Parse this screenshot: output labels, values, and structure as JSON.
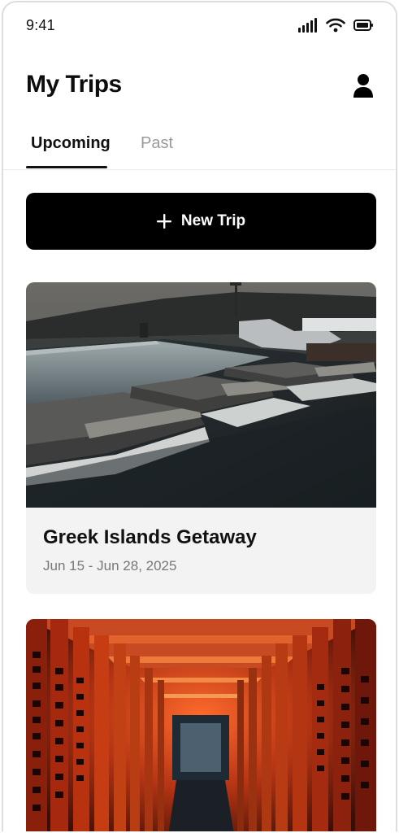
{
  "status_bar": {
    "time": "9:41",
    "icons": [
      "cellular-signal-icon",
      "wifi-icon",
      "battery-icon"
    ]
  },
  "header": {
    "title": "My Trips",
    "profile_icon": "user-icon"
  },
  "tabs": [
    {
      "label": "Upcoming",
      "active": true
    },
    {
      "label": "Past",
      "active": false
    }
  ],
  "new_trip_button": {
    "label": "New Trip",
    "icon": "plus-icon"
  },
  "trips": [
    {
      "title": "Greek Islands Getaway",
      "dates": "Jun 15 - Jun 28, 2025",
      "image": "infinity pool with lounge beds overlooking the sea at dusk"
    },
    {
      "title": "",
      "dates": "",
      "image": "tunnel of red torii gates with black Japanese inscriptions"
    }
  ],
  "colors": {
    "primary": "#000000",
    "active_tab": "#111111",
    "inactive_tab": "#9a9a9a",
    "card_background": "#f3f3f3",
    "subtext": "#777777"
  }
}
